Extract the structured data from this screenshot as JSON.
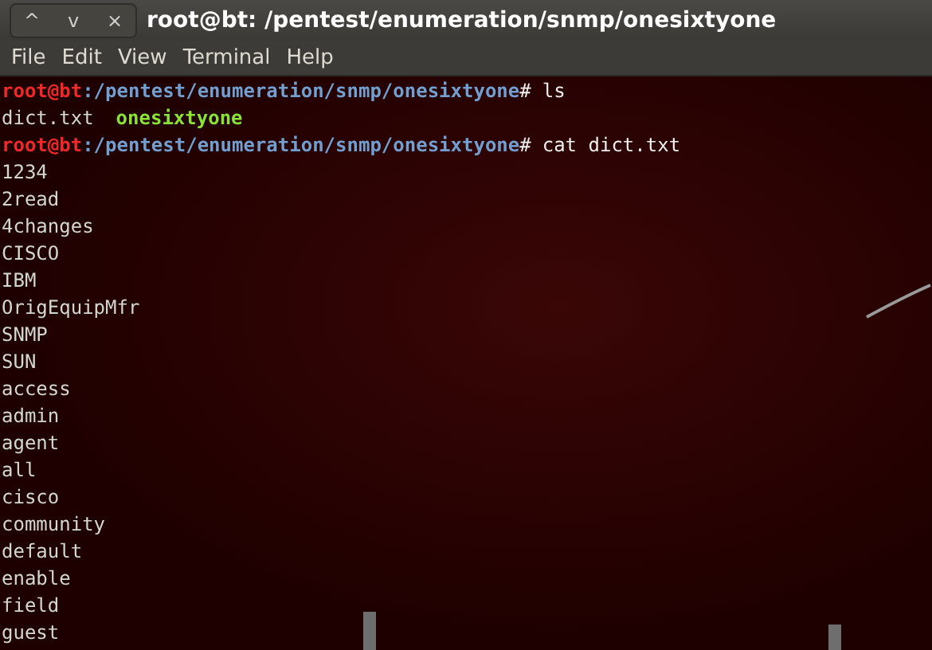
{
  "window": {
    "title": "root@bt: /pentest/enumeration/snmp/onesixtyone",
    "controls": [
      "^",
      "v",
      "×"
    ]
  },
  "menu": [
    "File",
    "Edit",
    "View",
    "Terminal",
    "Help"
  ],
  "terminal": {
    "lines": [
      {
        "kind": "prompt",
        "user": "root@bt",
        "path": ":/pentest/enumeration/snmp/onesixtyone",
        "symbol": "#",
        "command": "ls"
      },
      {
        "kind": "listing",
        "entries": [
          {
            "name": "dict.txt",
            "kind": "file"
          },
          {
            "name": "onesixtyone",
            "kind": "executable"
          }
        ]
      },
      {
        "kind": "prompt",
        "user": "root@bt",
        "path": ":/pentest/enumeration/snmp/onesixtyone",
        "symbol": "#",
        "command": "cat dict.txt"
      },
      {
        "kind": "output",
        "text": "1234"
      },
      {
        "kind": "output",
        "text": "2read"
      },
      {
        "kind": "output",
        "text": "4changes"
      },
      {
        "kind": "output",
        "text": "CISCO"
      },
      {
        "kind": "output",
        "text": "IBM"
      },
      {
        "kind": "output",
        "text": "OrigEquipMfr"
      },
      {
        "kind": "output",
        "text": "SNMP"
      },
      {
        "kind": "output",
        "text": "SUN"
      },
      {
        "kind": "output",
        "text": "access"
      },
      {
        "kind": "output",
        "text": "admin"
      },
      {
        "kind": "output",
        "text": "agent"
      },
      {
        "kind": "output",
        "text": "all"
      },
      {
        "kind": "output",
        "text": "cisco"
      },
      {
        "kind": "output",
        "text": "community"
      },
      {
        "kind": "output",
        "text": "default"
      },
      {
        "kind": "output",
        "text": "enable"
      },
      {
        "kind": "output",
        "text": "field"
      },
      {
        "kind": "output",
        "text": "guest"
      }
    ]
  }
}
